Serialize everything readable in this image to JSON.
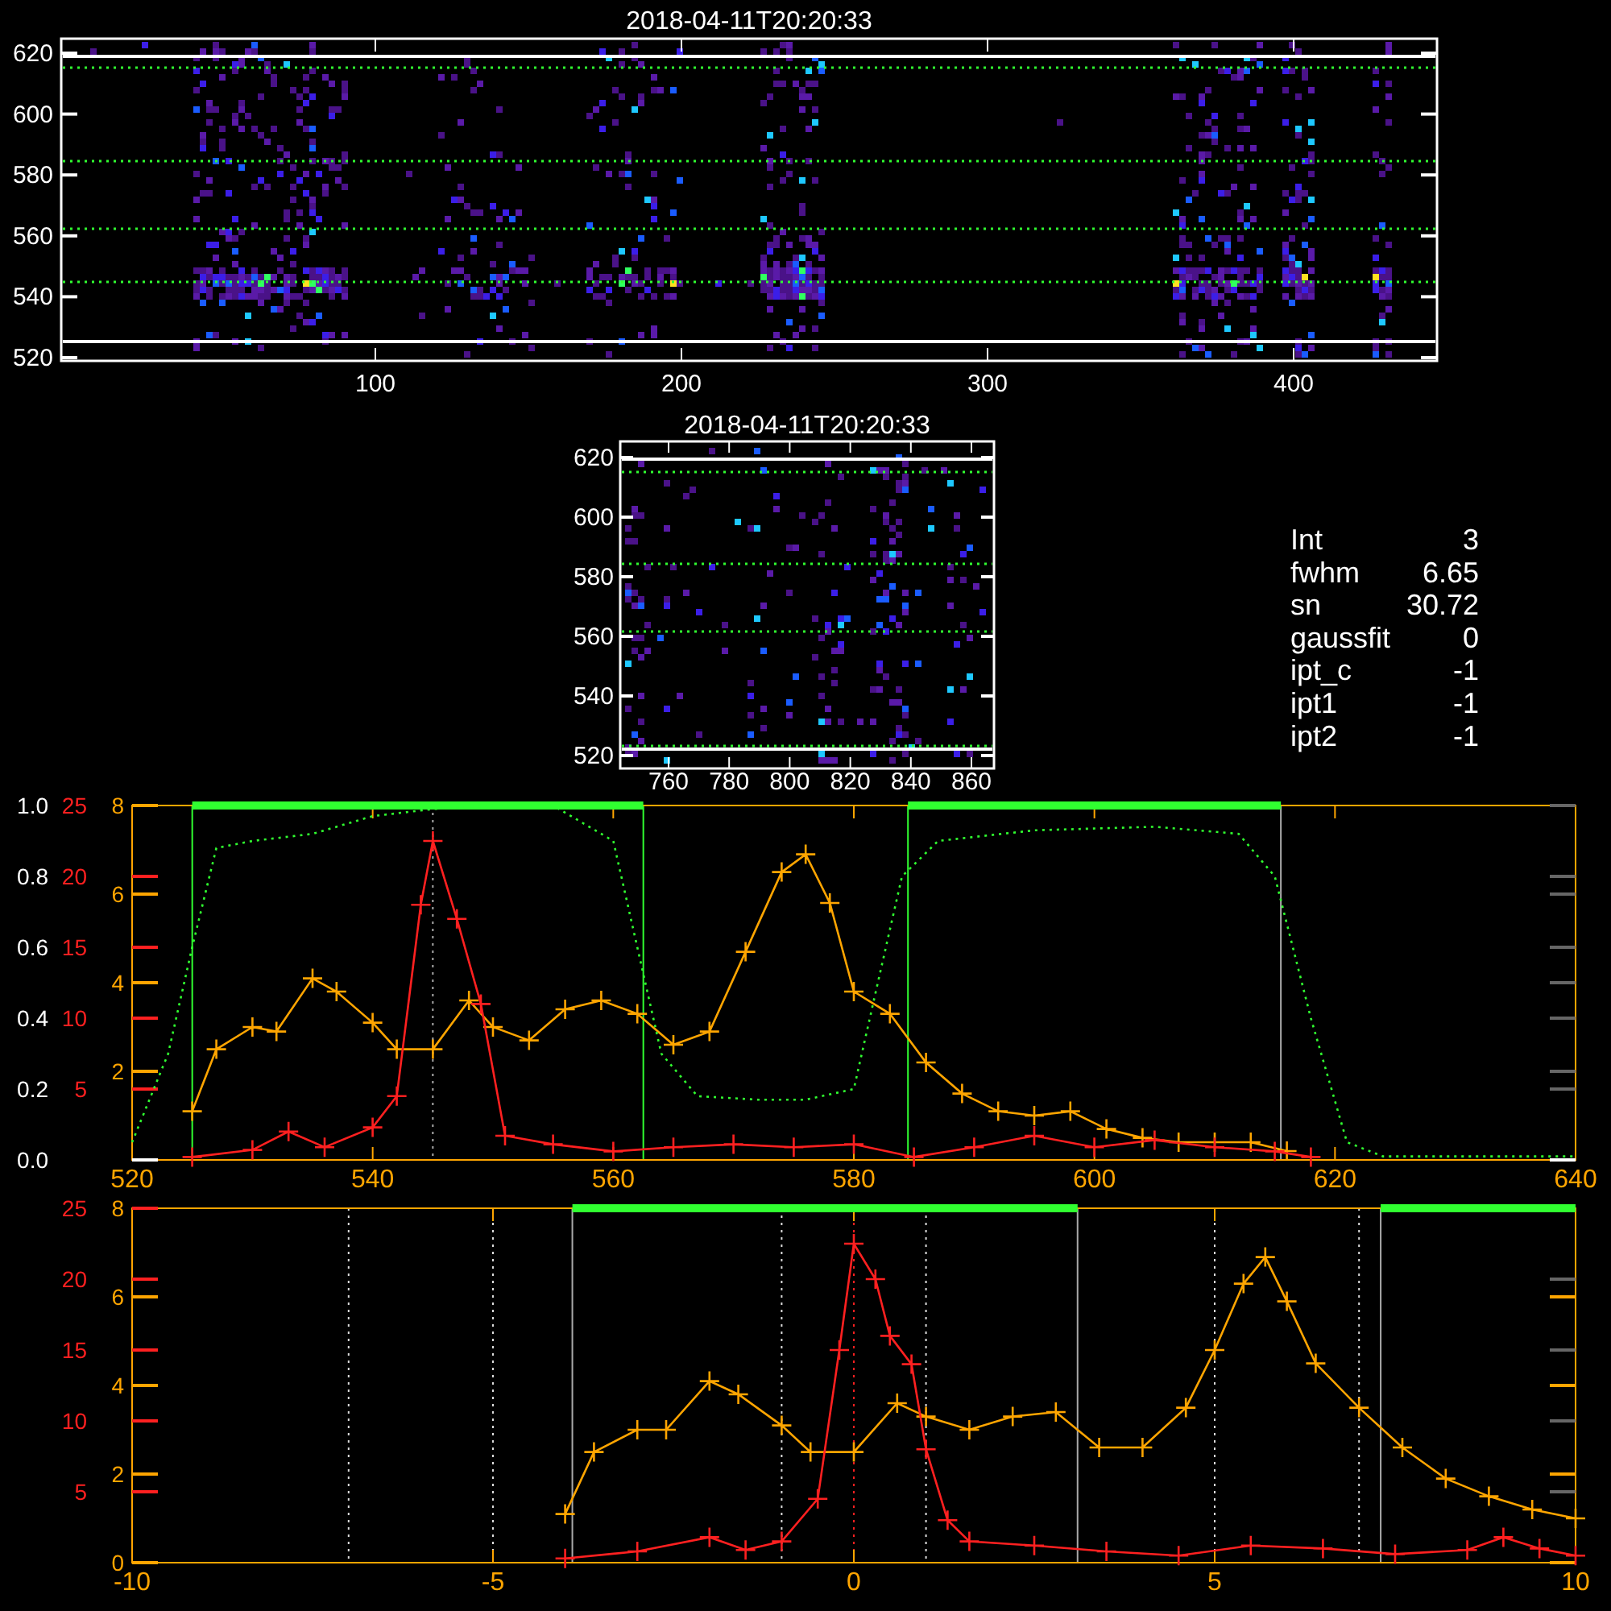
{
  "image_panels": [
    {
      "title": "2018-04-11T20:20:33",
      "xticks": [
        "100",
        "200",
        "300",
        "400"
      ],
      "yticks": [
        "620",
        "600",
        "580",
        "560",
        "540",
        "520"
      ]
    },
    {
      "title": "2018-04-11T20:20:33",
      "xticks": [
        "760",
        "780",
        "800",
        "820",
        "840",
        "860"
      ],
      "yticks": [
        "620",
        "600",
        "580",
        "560",
        "540",
        "520"
      ]
    }
  ],
  "fit_parameters": [
    {
      "label": "Int",
      "value": "3"
    },
    {
      "label": "fwhm",
      "value": "6.65"
    },
    {
      "label": "sn",
      "value": "30.72"
    },
    {
      "label": "gaussfit",
      "value": "0"
    },
    {
      "label": "ipt_c",
      "value": "-1"
    },
    {
      "label": "ipt1",
      "value": "-1"
    },
    {
      "label": "ipt2",
      "value": "-1"
    }
  ],
  "line_plots": [
    {
      "chart_data": {
        "type": "line",
        "xlim": [
          520,
          640
        ],
        "xticks": [
          520,
          540,
          560,
          580,
          600,
          620,
          640
        ],
        "ylim": [
          0,
          1
        ],
        "yticks": [
          {
            "value": 0,
            "label": "0.0"
          },
          {
            "value": 0.2,
            "label": "0.2"
          },
          {
            "value": 0.4,
            "label": "0.4"
          },
          {
            "value": 0.6,
            "label": "0.6"
          },
          {
            "value": 0.8,
            "label": "0.8"
          },
          {
            "value": 1,
            "label": "1.0"
          }
        ],
        "y2lim": [
          0,
          25
        ],
        "y2ticks": [
          5,
          10,
          15,
          20,
          25
        ],
        "y3lim": [
          0,
          8
        ],
        "y3ticks": [
          2,
          4,
          6,
          8
        ],
        "ref_lines": [
          {
            "axis": "x",
            "value": 525,
            "color": "#30ff30",
            "line_style": "solid"
          },
          {
            "axis": "x",
            "value": 562.5,
            "color": "#30ff30",
            "line_style": "solid"
          },
          {
            "axis": "x",
            "value": 584.5,
            "color": "#30ff30",
            "line_style": "solid"
          },
          {
            "axis": "x",
            "value": 615.5,
            "color": "#aaaaaa",
            "line_style": "solid"
          },
          {
            "axis": "x",
            "value": 545,
            "color": "#aaaaaa",
            "line_style": "dotted"
          }
        ],
        "series": [
          {
            "color": "#ffa500",
            "axis": "y3",
            "marker": "+",
            "x": [
              525,
              527,
              530,
              532,
              535,
              537,
              540,
              542,
              545,
              548,
              550,
              553,
              556,
              559,
              562,
              565,
              568,
              571,
              574,
              576,
              578,
              580,
              583,
              586,
              589,
              592,
              595,
              598,
              601,
              604,
              607,
              610,
              613,
              616
            ],
            "values": [
              1.1,
              2.5,
              3.0,
              2.9,
              4.1,
              3.8,
              3.1,
              2.5,
              2.5,
              3.6,
              3.0,
              2.7,
              3.4,
              3.6,
              3.3,
              2.6,
              2.9,
              4.7,
              6.5,
              6.9,
              5.8,
              3.8,
              3.3,
              2.2,
              1.5,
              1.1,
              1.0,
              1.1,
              0.7,
              0.5,
              0.4,
              0.4,
              0.4,
              0.2
            ]
          },
          {
            "color": "#ff2020",
            "axis": "y2",
            "marker": "+",
            "x": [
              525,
              530,
              533,
              536,
              540,
              542,
              544,
              545,
              547,
              549,
              551,
              555,
              560,
              565,
              570,
              575,
              580,
              585,
              590,
              595,
              600,
              605,
              610,
              615,
              618
            ],
            "values": [
              0.2,
              0.7,
              2.0,
              0.9,
              2.3,
              4.5,
              18,
              22.5,
              17,
              11,
              1.7,
              1.1,
              0.6,
              0.9,
              1.1,
              0.9,
              1.1,
              0.2,
              0.9,
              1.7,
              0.9,
              1.4,
              0.9,
              0.6,
              0.2
            ]
          },
          {
            "color": "#30ff30",
            "line_style": "solid",
            "x": [
              525,
              562.5,
              563,
              584.5,
              615.5
            ],
            "values": [
              1,
              1,
              null,
              1,
              1
            ]
          },
          {
            "color": "#30ff30",
            "line_style": "dotted",
            "x": [
              520,
              523,
              525,
              527,
              530,
              535,
              540,
              545,
              550,
              555,
              560,
              562,
              564,
              567,
              572,
              576,
              580,
              582,
              584,
              587,
              595,
              605,
              612,
              615,
              618,
              621,
              624,
              640
            ],
            "values": [
              0.05,
              0.3,
              0.6,
              0.88,
              0.9,
              0.92,
              0.97,
              0.99,
              1.0,
              1.0,
              0.9,
              0.6,
              0.3,
              0.18,
              0.17,
              0.17,
              0.2,
              0.5,
              0.8,
              0.9,
              0.93,
              0.94,
              0.92,
              0.8,
              0.4,
              0.05,
              0.01,
              0.01
            ]
          }
        ]
      }
    },
    {
      "chart_data": {
        "type": "line",
        "xlim": [
          -10,
          10
        ],
        "xticks": [
          -10,
          -5,
          0,
          5,
          10
        ],
        "ylim": [
          0,
          8
        ],
        "yticks": [
          0,
          2,
          4,
          6,
          8
        ],
        "y2lim": [
          0,
          25
        ],
        "y2ticks": [
          5,
          10,
          15,
          20,
          25
        ],
        "ref_lines": [
          {
            "axis": "x",
            "value": -3.9,
            "color": "#aaaaaa",
            "line_style": "solid"
          },
          {
            "axis": "x",
            "value": 3.1,
            "color": "#aaaaaa",
            "line_style": "solid"
          },
          {
            "axis": "x",
            "value": 7.3,
            "color": "#aaaaaa",
            "line_style": "solid"
          },
          {
            "axis": "x",
            "value": -7,
            "color": "#dddddd",
            "line_style": "dotted"
          },
          {
            "axis": "x",
            "value": -5,
            "color": "#dddddd",
            "line_style": "dotted"
          },
          {
            "axis": "x",
            "value": -1,
            "color": "#dddddd",
            "line_style": "dotted"
          },
          {
            "axis": "x",
            "value": 1,
            "color": "#dddddd",
            "line_style": "dotted"
          },
          {
            "axis": "x",
            "value": 5,
            "color": "#dddddd",
            "line_style": "dotted"
          },
          {
            "axis": "x",
            "value": 7,
            "color": "#dddddd",
            "line_style": "dotted"
          },
          {
            "axis": "x",
            "value": 0,
            "color": "#ff2020",
            "line_style": "dotted"
          }
        ],
        "series": [
          {
            "color": "#30ff30",
            "line_style": "solid",
            "x": [
              -3.9,
              3.1,
              3.2,
              7.3,
              10
            ],
            "values": [
              8,
              8,
              null,
              8,
              8
            ]
          },
          {
            "color": "#ffa500",
            "marker": "+",
            "x": [
              -4,
              -3.6,
              -3,
              -2.6,
              -2,
              -1.6,
              -1,
              -0.6,
              0,
              0.6,
              1,
              1.6,
              2.2,
              2.8,
              3.4,
              4,
              4.6,
              5,
              5.4,
              5.7,
              6,
              6.4,
              7,
              7.6,
              8.2,
              8.8,
              9.4,
              10
            ],
            "values": [
              1.1,
              2.5,
              3.0,
              3.0,
              4.1,
              3.8,
              3.1,
              2.5,
              2.5,
              3.6,
              3.3,
              3.0,
              3.3,
              3.4,
              2.6,
              2.6,
              3.5,
              4.8,
              6.3,
              6.9,
              5.9,
              4.5,
              3.5,
              2.6,
              1.9,
              1.5,
              1.2,
              1.0
            ]
          },
          {
            "color": "#ff2020",
            "axis": "y2",
            "marker": "+",
            "x": [
              -4,
              -3,
              -2,
              -1.5,
              -1,
              -0.5,
              -0.2,
              0,
              0.3,
              0.5,
              0.8,
              1,
              1.3,
              1.6,
              2.5,
              3.5,
              4.5,
              5.5,
              6.5,
              7.5,
              8.5,
              9,
              9.5,
              10
            ],
            "values": [
              0.3,
              0.8,
              1.8,
              0.9,
              1.5,
              4.5,
              15,
              22.5,
              20,
              16,
              14,
              8,
              3,
              1.5,
              1.2,
              0.8,
              0.5,
              1.2,
              1,
              0.6,
              0.9,
              1.8,
              1,
              0.5
            ]
          }
        ]
      }
    }
  ]
}
